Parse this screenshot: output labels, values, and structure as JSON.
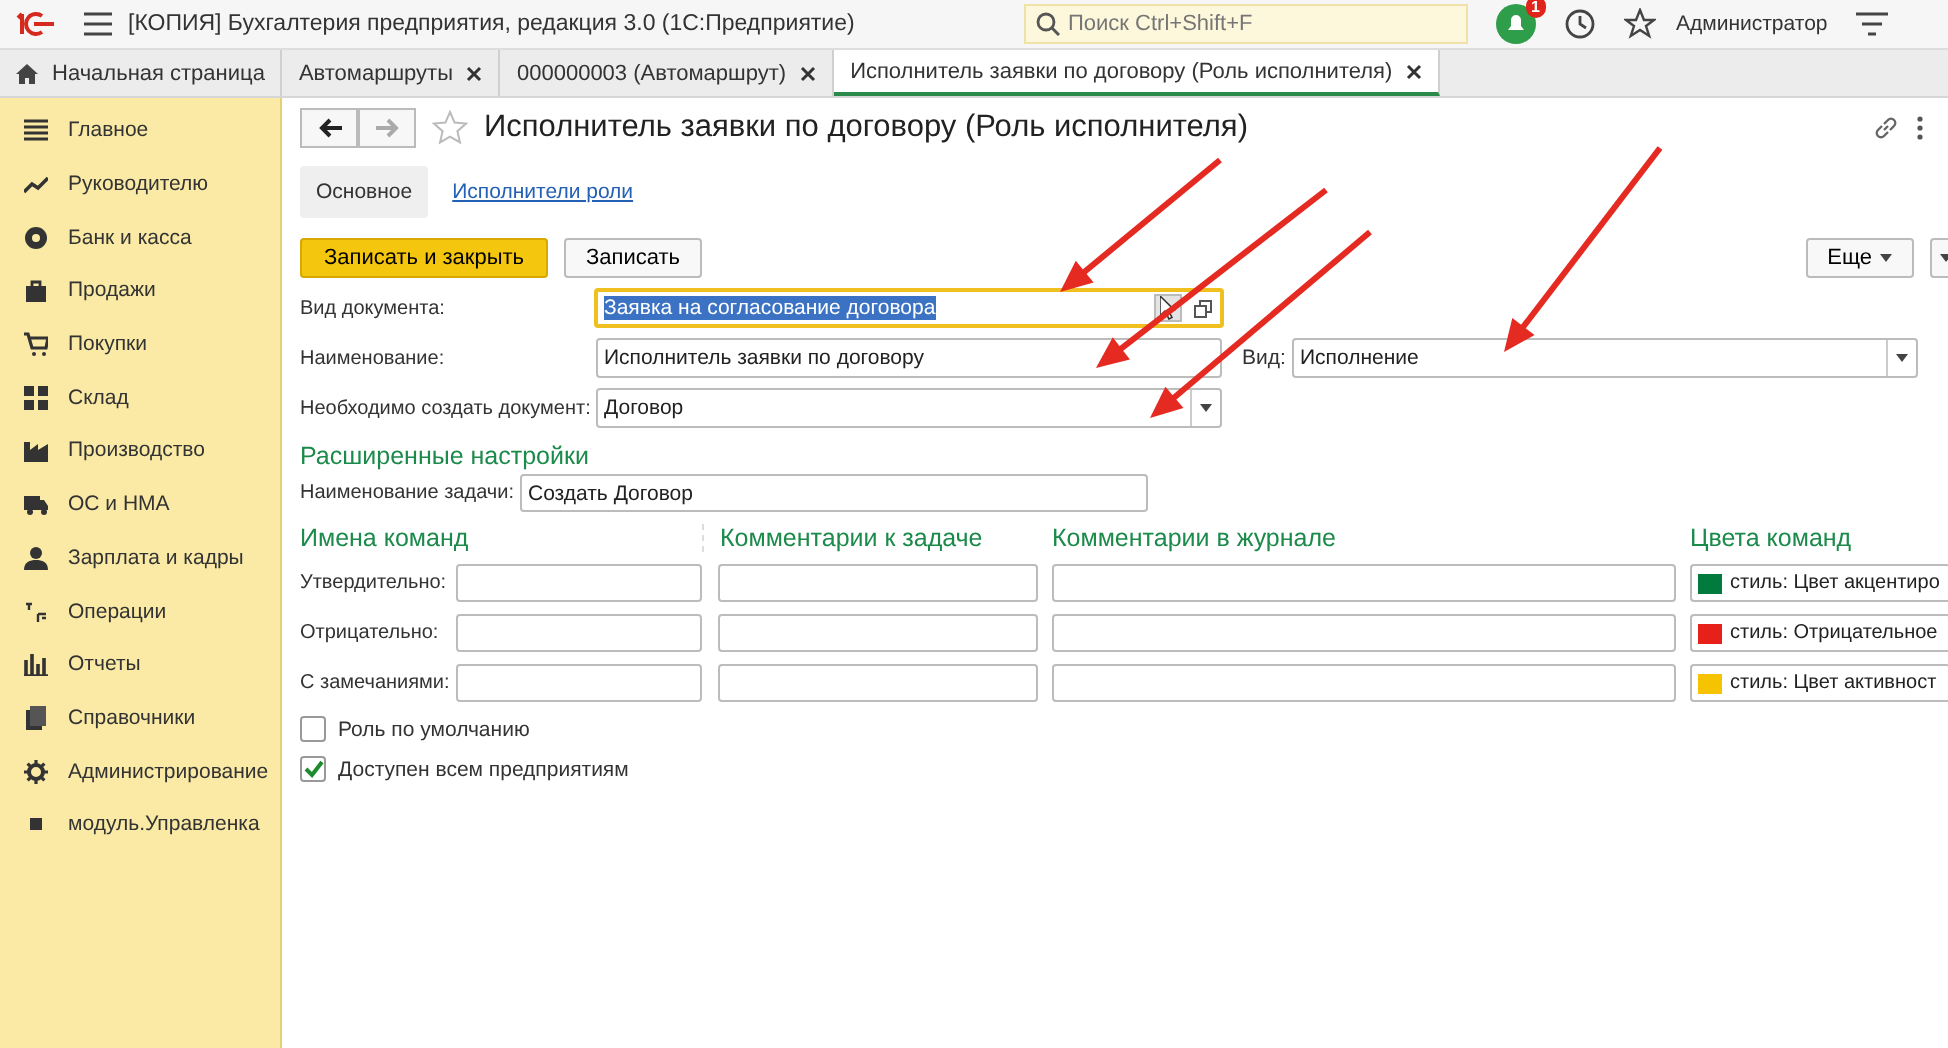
{
  "app_bar": {
    "title": "[КОПИЯ] Бухгалтерия предприятия, редакция 3.0  (1С:Предприятие)",
    "search": {
      "placeholder": "Поиск Ctrl+Shift+F"
    },
    "notifications": "1",
    "user": "Администратор"
  },
  "open_tabs": [
    {
      "label": "Начальная страница",
      "kind": "home",
      "selected": false
    },
    {
      "label": "Автомаршруты",
      "kind": "closable",
      "selected": false
    },
    {
      "label": "000000003 (Автомаршрут)",
      "kind": "closable",
      "selected": false
    },
    {
      "label": "Исполнитель заявки по договору (Роль исполнителя)",
      "kind": "closable",
      "selected": true
    }
  ],
  "sidebar": {
    "items": [
      {
        "label": "Главное"
      },
      {
        "label": "Руководителю"
      },
      {
        "label": "Банк и касса"
      },
      {
        "label": "Продажи"
      },
      {
        "label": "Покупки"
      },
      {
        "label": "Склад"
      },
      {
        "label": "Производство"
      },
      {
        "label": "ОС и НМА"
      },
      {
        "label": "Зарплата и кадры"
      },
      {
        "label": "Операции"
      },
      {
        "label": "Отчеты"
      },
      {
        "label": "Справочники"
      },
      {
        "label": "Администрирование"
      },
      {
        "label": "модуль.Управленка"
      }
    ]
  },
  "form": {
    "title": "Исполнитель заявки по договору (Роль исполнителя)",
    "sections": [
      {
        "label": "Основное",
        "selected": true
      },
      {
        "label": "Исполнители роли",
        "selected": false
      }
    ],
    "buttons": [
      {
        "label": "Записать и закрыть",
        "kind": "primary"
      },
      {
        "label": "Записать",
        "kind": "normal"
      }
    ],
    "more_button": "Еще",
    "fields": [
      {
        "label": "Вид документа:",
        "value": "Заявка на согласование договора",
        "kind": "select",
        "focused": true
      },
      {
        "label": "Наименование:",
        "value": "Исполнитель заявки по договору",
        "kind": "text",
        "focused": false
      },
      {
        "label": "Необходимо создать документ:",
        "value": "Договор",
        "kind": "dropdown",
        "focused": false
      }
    ],
    "side_field": {
      "label": "Вид:",
      "value": "Исполнение",
      "kind": "dropdown"
    },
    "advanced": {
      "title": "Расширенные настройки",
      "task_label": "Наименование задачи:",
      "task_value": "Создать Договор"
    },
    "commands": {
      "columns": [
        "Имена команд",
        "Комментарии к задаче",
        "Комментарии в журнале",
        "Цвета команд"
      ],
      "rows": [
        {
          "label": "Утвердительно:",
          "color": "#007a3d",
          "style": "стиль: Цвет акцентиро"
        },
        {
          "label": "Отрицательно:",
          "color": "#e8201a",
          "style": "стиль: Отрицательное"
        },
        {
          "label": "С замечаниями:",
          "color": "#f5c300",
          "style": "стиль: Цвет активност"
        }
      ]
    },
    "checkboxes": [
      {
        "label": "Роль по умолчанию",
        "checked": false
      },
      {
        "label": "Доступен всем предприятиям",
        "checked": true
      }
    ]
  }
}
